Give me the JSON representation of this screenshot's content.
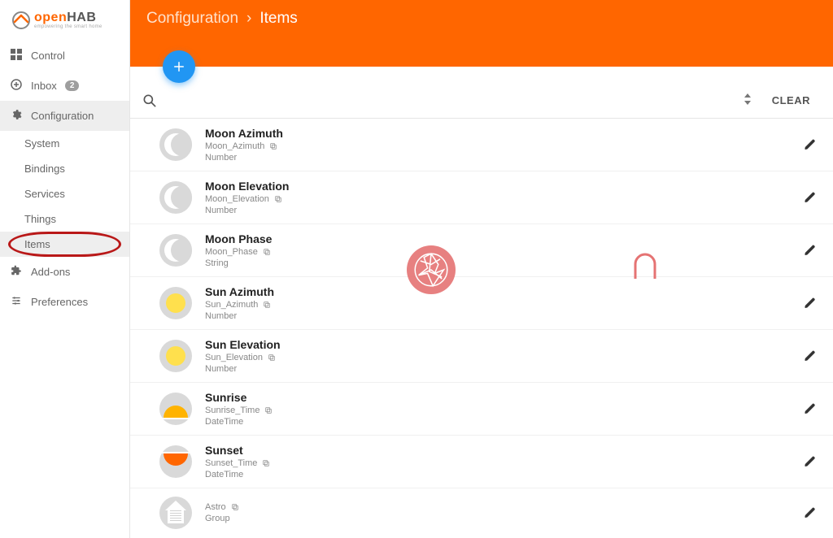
{
  "logo": {
    "text_open": "open",
    "text_hab": "HAB",
    "tagline": "empowering the smart home"
  },
  "nav": {
    "control": "Control",
    "inbox": "Inbox",
    "inbox_badge": "2",
    "configuration": "Configuration",
    "addons": "Add-ons",
    "preferences": "Preferences",
    "config_sub": {
      "system": "System",
      "bindings": "Bindings",
      "services": "Services",
      "things": "Things",
      "items": "Items"
    }
  },
  "breadcrumb": {
    "parent": "Configuration",
    "sep": "›",
    "current": "Items"
  },
  "toolbar": {
    "clear": "CLEAR"
  },
  "items": [
    {
      "name": "Moon Azimuth",
      "id": "Moon_Azimuth",
      "type": "Number",
      "icon": "moon"
    },
    {
      "name": "Moon Elevation",
      "id": "Moon_Elevation",
      "type": "Number",
      "icon": "moon"
    },
    {
      "name": "Moon Phase",
      "id": "Moon_Phase",
      "type": "String",
      "icon": "moon"
    },
    {
      "name": "Sun Azimuth",
      "id": "Sun_Azimuth",
      "type": "Number",
      "icon": "sun"
    },
    {
      "name": "Sun Elevation",
      "id": "Sun_Elevation",
      "type": "Number",
      "icon": "sun"
    },
    {
      "name": "Sunrise",
      "id": "Sunrise_Time",
      "type": "DateTime",
      "icon": "sunrise"
    },
    {
      "name": "Sunset",
      "id": "Sunset_Time",
      "type": "DateTime",
      "icon": "sunset"
    },
    {
      "name": "",
      "id": "Astro",
      "type": "Group",
      "icon": "house"
    }
  ]
}
